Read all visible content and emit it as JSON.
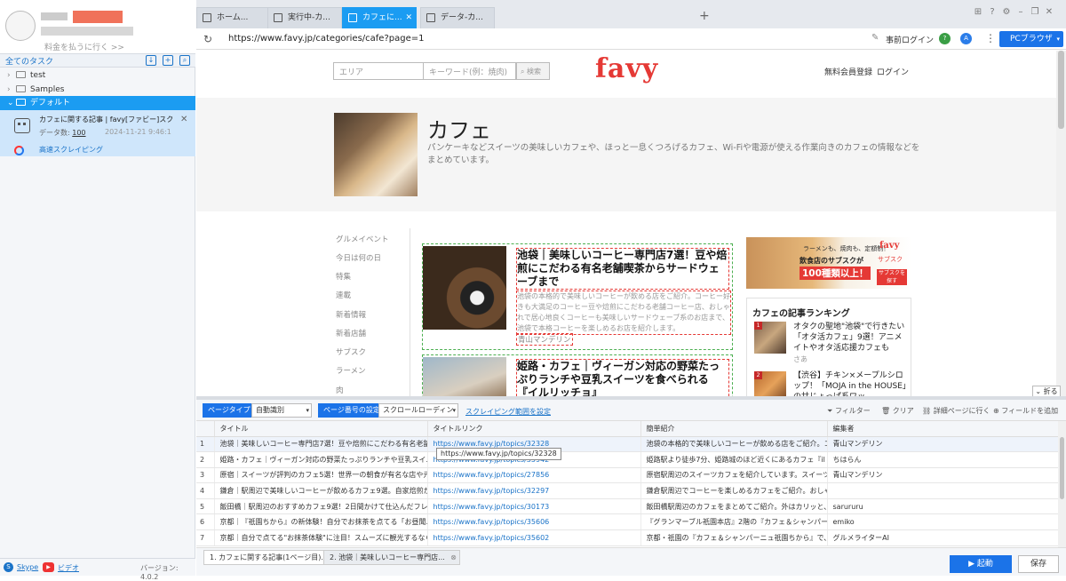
{
  "sidebar": {
    "pay_link": "料金を払うに行く >>",
    "all_tasks": "全てのタスク",
    "folders": [
      "test",
      "Samples",
      "デフォルト"
    ],
    "task": {
      "title": "カフェに関する記事 | favy[ファビー]スク...",
      "data_label": "データ数:",
      "data_count": "100",
      "date": "2024-11-21 9:46:1",
      "mode": "高速スクレイピング"
    },
    "footer": {
      "skype": "Skype",
      "video": "ビデオ",
      "version": "バージョン: 4.0.2"
    }
  },
  "tabs": [
    "ホーム...",
    "実行中-カ...",
    "カフェに...",
    "データ-カ..."
  ],
  "address": {
    "url": "https://www.favy.jp/categories/cafe?page=1",
    "prelogin": "事前ログイン",
    "browser": "PCブラウザ"
  },
  "web": {
    "area_placeholder": "エリア",
    "keyword_placeholder": "キーワード(例：焼肉)",
    "search": "検索",
    "logo": "favy",
    "register": "無料会員登録",
    "login": "ログイン",
    "cat_title": "カフェ",
    "cat_desc": "パンケーキなどスイーツの美味しいカフェや、ほっと一息くつろげるカフェ、Wi-Fiや電源が使える作業向きのカフェの情報などをまとめています。",
    "side_nav": [
      "グルメイベント",
      "今日は何の日",
      "特集",
      "連載",
      "新着情報",
      "新着店舗",
      "サブスク",
      "ラーメン",
      "肉"
    ],
    "articles": [
      {
        "title": "池袋｜美味しいコーヒー専門店7選！豆や焙煎にこだわる有名老舗喫茶からサードウェーブまで",
        "desc": "池袋の本格的で美味しいコーヒーが飲める店をご紹介。コーヒー好きも大満足のコーヒー豆や焙煎にこだわる老舗コーヒー店、おしゃれで居心地良くコーヒーも美味しいサードウェーブ系のお店まで、池袋で本格コーヒーを楽しめるお店を紹介します。",
        "author": "青山マンデリン"
      },
      {
        "title": "姫路・カフェ｜ヴィーガン対応の野菜たっぷりランチや豆乳スイーツを食べられる『イルリッチョ』"
      }
    ],
    "banner": {
      "line1": "ラーメンも、焼肉も、定額制！",
      "line2": "飲食店のサブスクが",
      "line3": "100種類以上！",
      "logo": "favy",
      "logo_sub": "サブスク",
      "cta": "サブスクを探す"
    },
    "ranking": {
      "title": "カフェの記事ランキング",
      "items": [
        {
          "no": "1",
          "title": "オタクの聖地\"池袋\"で行きたい「オタ活カフェ」9選！アニメイトやオタ活応援カフェも",
          "author": "さあ"
        },
        {
          "no": "2",
          "title": "【渋谷】チキン×メープルシロップ！「MOJA in the HOUSE」の甘じょっぱ系ワッ"
        }
      ]
    },
    "fold": "折る"
  },
  "toolbar": {
    "page_type": "ページタイプ",
    "auto": "自動識別",
    "page_num": "ページ番号の設定",
    "scroll": "スクロールローディン",
    "scrape_range": "スクレイピング範囲を設定",
    "filter": "フィルター",
    "clear": "クリア",
    "detail": "詳細ページに行く",
    "add_field": "フィールドを追加"
  },
  "grid": {
    "columns": [
      "タイトル",
      "タイトルリンク",
      "簡単紹介",
      "編集者"
    ],
    "rows": [
      [
        "1",
        "池袋｜美味しいコーヒー専門店7選！豆や焙煎にこだわる有名老舗...",
        "https://www.favy.jp/topics/32328",
        "池袋の本格的で美味しいコーヒーが飲める店をご紹介。コーヒー...",
        "青山マンデリン"
      ],
      [
        "2",
        "姫路・カフェ｜ヴィーガン対応の野菜たっぷりランチや豆乳スイ...",
        "https://www.favy.jp/topics/35942",
        "姫路駅より徒歩7分、姫路城のほど近くにあるカフェ『il riccio -イ...",
        "ちはらん"
      ],
      [
        "3",
        "原宿｜スイーツが評判のカフェ5選！世界一の朝食が有名な店や元...",
        "https://www.favy.jp/topics/27856",
        "原宿駅周辺のスイーツカフェを紹介しています。スイーツ激戦...",
        "青山マンデリン"
      ],
      [
        "4",
        "鎌倉｜駅周辺で美味しいコーヒーが飲めるカフェ9選。自家焙煎か...",
        "https://www.favy.jp/topics/32297",
        "鎌倉駅周辺でコーヒーを楽しめるカフェをご紹介。おしゃれな空...",
        ""
      ],
      [
        "5",
        "飯田橋｜駅周辺のおすすめカフェ9選！2日間かけて仕込んだフレ...",
        "https://www.favy.jp/topics/30173",
        "飯田橋駅周辺のカフェをまとめてご紹介。外はカリッと、中はプ...",
        "sarururu"
      ],
      [
        "6",
        "京都｜『祇園ちから』の新体験！自分でお抹茶を点てる「お昼聞...",
        "https://www.favy.jp/topics/35606",
        "『グランマーブル祇園本店』2階の『カフェ＆シャンパーニュ祇園...",
        "emiko"
      ],
      [
        "7",
        "京都｜自分で点てる\"お抹茶体験\"に注目！スムーズに観光するなら...",
        "https://www.favy.jp/topics/35602",
        "京都・祇園の『カフェ＆シャンパーニュ祇園ちから』で、抹茶を...",
        "グルメライターAI"
      ]
    ],
    "tooltip": "https://www.favy.jp/topics/32328"
  },
  "bottom": {
    "tabs": [
      "1. カフェに関する記事(1ページ目)...",
      "2. 池袋｜美味しいコーヒー専門店..."
    ],
    "run": "起動",
    "save": "保存"
  }
}
